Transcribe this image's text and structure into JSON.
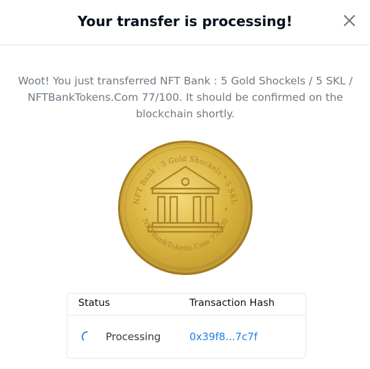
{
  "modal": {
    "title": "Your transfer is processing!",
    "close_icon": "close-icon",
    "message": "Woot! You just transferred NFT Bank : 5 Gold Shockels / 5 SKL / NFTBankTokens.Com 77/100. It should be confirmed on the blockchain shortly."
  },
  "coin": {
    "top_text": "NFT Bank : 5 Gold Shockels * 5 SKL",
    "bottom_text": "NFTBankTokens.Com 77/100",
    "icon": "bank-building-icon",
    "colors": {
      "gold_light": "#f1d46a",
      "gold": "#d9b33a",
      "gold_dark": "#a9822a"
    }
  },
  "table": {
    "headers": {
      "status": "Status",
      "hash": "Transaction Hash"
    },
    "rows": [
      {
        "status": "Processing",
        "hash": "0x39f8...7c7f",
        "status_icon": "spinner-icon"
      }
    ]
  },
  "colors": {
    "link": "#2081e2",
    "muted_text": "#707a83",
    "border": "#e5e8eb",
    "spinner": "#2081e2"
  }
}
